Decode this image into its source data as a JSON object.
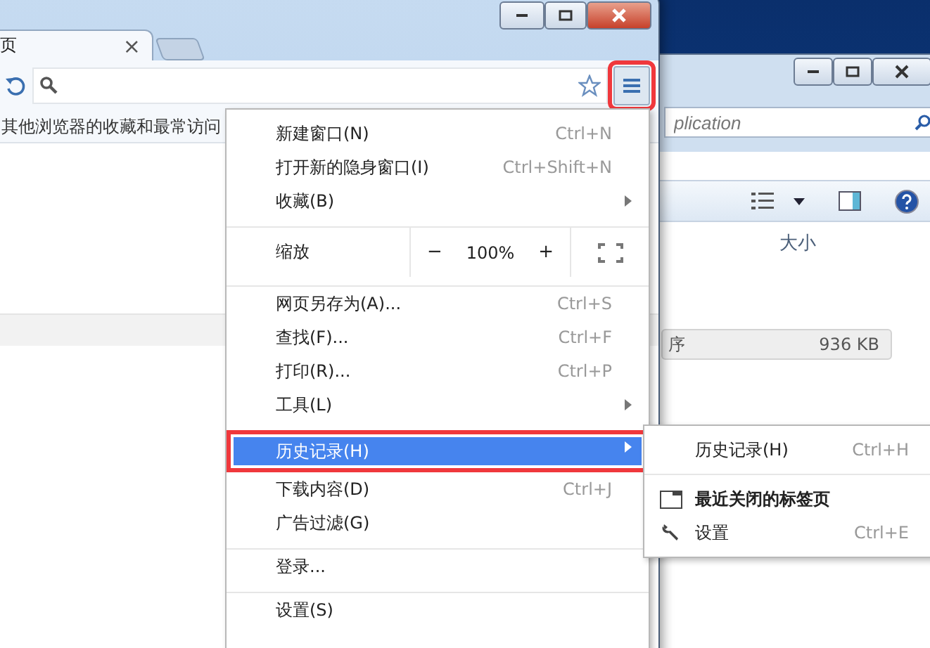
{
  "explorer_window": {
    "search": {
      "placeholder": "plication"
    },
    "columns": [
      "大小"
    ],
    "rows": [
      {
        "name": "序",
        "size": "936 KB",
        "selected": true
      }
    ]
  },
  "browser_window": {
    "tab": {
      "title": "页",
      "close": "×"
    },
    "menu_button": {
      "annotated": true
    },
    "bookmark_bar_text": "其他浏览器的收藏和最常访问",
    "menu": [
      {
        "kind": "item",
        "label": "新建窗口(N)",
        "shortcut": "Ctrl+N",
        "submenu": false,
        "selected": false,
        "annotated": false
      },
      {
        "kind": "item",
        "label": "打开新的隐身窗口(I)",
        "shortcut": "Ctrl+Shift+N",
        "submenu": false,
        "selected": false,
        "annotated": false
      },
      {
        "kind": "item",
        "label": "收藏(B)",
        "submenu": true,
        "selected": false,
        "annotated": false
      },
      {
        "kind": "separator"
      },
      {
        "kind": "zoom",
        "label": "缩放",
        "minus": "−",
        "value": "100%",
        "plus": "+"
      },
      {
        "kind": "separator"
      },
      {
        "kind": "item",
        "label": "网页另存为(A)...",
        "shortcut": "Ctrl+S",
        "submenu": false,
        "selected": false,
        "annotated": false
      },
      {
        "kind": "item",
        "label": "查找(F)...",
        "shortcut": "Ctrl+F",
        "submenu": false,
        "selected": false,
        "annotated": false
      },
      {
        "kind": "item",
        "label": "打印(R)...",
        "shortcut": "Ctrl+P",
        "submenu": false,
        "selected": false,
        "annotated": false
      },
      {
        "kind": "item",
        "label": "工具(L)",
        "submenu": true,
        "selected": false,
        "annotated": false
      },
      {
        "kind": "item",
        "label": "历史记录(H)",
        "submenu": true,
        "selected": true,
        "annotated": true
      },
      {
        "kind": "item",
        "label": "下载内容(D)",
        "shortcut": "Ctrl+J",
        "submenu": false,
        "selected": false,
        "annotated": false
      },
      {
        "kind": "item",
        "label": "广告过滤(G)",
        "submenu": false,
        "selected": false,
        "annotated": false
      },
      {
        "kind": "separator"
      },
      {
        "kind": "item",
        "label": "登录...",
        "submenu": false,
        "selected": false,
        "annotated": false
      },
      {
        "kind": "separator"
      },
      {
        "kind": "item",
        "label": "设置(S)",
        "submenu": false,
        "selected": false,
        "annotated": false
      }
    ],
    "submenu": [
      {
        "kind": "item",
        "label": "历史记录(H)",
        "shortcut": "Ctrl+H",
        "bold": false
      },
      {
        "kind": "separator"
      },
      {
        "kind": "tab-item",
        "label": "最近关闭的标签页",
        "bold": true
      },
      {
        "kind": "wrench-item",
        "label": "设置",
        "shortcut": "Ctrl+E",
        "bold": false
      }
    ]
  }
}
